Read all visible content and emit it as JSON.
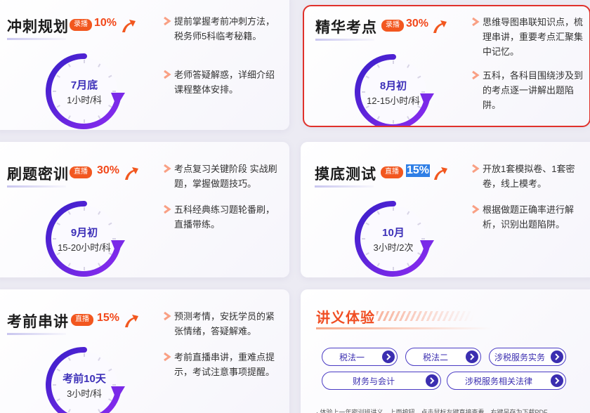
{
  "colors": {
    "title": "#1c1c1c",
    "tag_bg": "#f2571f",
    "percent": "#f2481a",
    "clock_ring": "#5a2de0",
    "accent_purple": "#3b2eb0",
    "highlight_border": "#e0312b",
    "selection": "#2f7fe6"
  },
  "cards": [
    {
      "title": "冲刺规划",
      "mode": "录播",
      "percent": "10%",
      "clock_main": "7月底",
      "clock_sub": "1小时/科",
      "bullets": [
        "提前掌握考前冲刺方法，税务师5科临考秘籍。",
        "老师答疑解惑，详细介绍课程整体安排。"
      ]
    },
    {
      "title": "精华考点",
      "mode": "录播",
      "percent": "30%",
      "clock_main": "8月初",
      "clock_sub": "12-15小时/科",
      "bullets": [
        "思维导图串联知识点，梳理串讲，重要考点汇聚集中记忆。",
        "五科，各科目围绕涉及到的考点逐一讲解出题陷阱。"
      ]
    },
    {
      "title": "刷题密训",
      "mode": "直播",
      "percent": "30%",
      "clock_main": "9月初",
      "clock_sub": "15-20小时/科",
      "bullets": [
        "考点复习关键阶段 实战刷题，掌握做题技巧。",
        "五科经典练习题轮番刷，直播带练。"
      ]
    },
    {
      "title": "摸底测试",
      "mode": "直播",
      "percent": "15%",
      "clock_main": "10月",
      "clock_sub": "3小时/2次",
      "bullets": [
        "开放1套模拟卷、1套密卷，线上模考。",
        "根据做题正确率进行解析，识别出题陷阱。"
      ]
    },
    {
      "title": "考前串讲",
      "mode": "直播",
      "percent": "15%",
      "clock_main": "考前10天",
      "clock_sub": "3小时/科",
      "bullets": [
        "预测考情，安抚学员的紧张情绪，答疑解难。",
        "考前直播串讲，重难点提示，考试注意事项提醒。"
      ]
    }
  ],
  "handout": {
    "title": "讲义体验",
    "buttons": [
      "税法一",
      "税法二",
      "涉税服务实务",
      "财务与会计",
      "涉税服务相关法律"
    ],
    "note": "· 体验上一年密训班讲义。上面按钮，点击鼠标左键直接查看，右键另存为下载PDF。"
  }
}
